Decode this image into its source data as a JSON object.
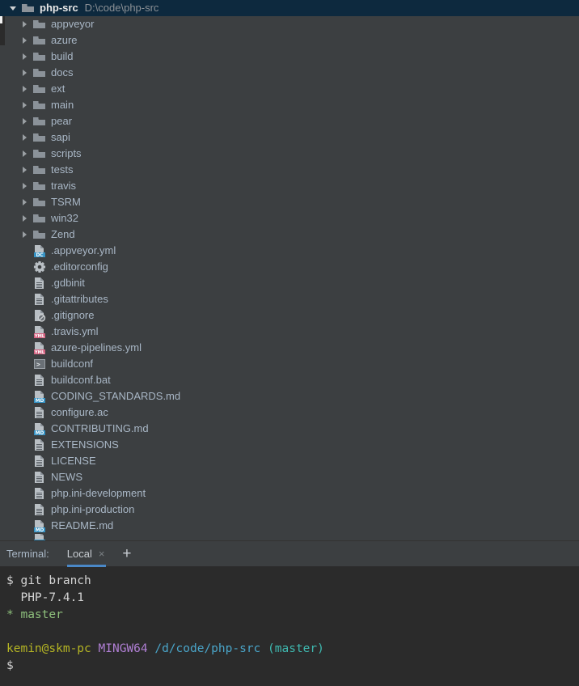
{
  "tree": {
    "root": {
      "name": "php-src",
      "path": "D:\\code\\php-src",
      "icon": "folder-icon",
      "twisty": "chevron-down-icon",
      "selected": true
    },
    "folders": [
      {
        "label": "appveyor",
        "icon": "folder-icon",
        "twisty": "chevron-right-icon"
      },
      {
        "label": "azure",
        "icon": "folder-icon",
        "twisty": "chevron-right-icon"
      },
      {
        "label": "build",
        "icon": "folder-icon",
        "twisty": "chevron-right-icon"
      },
      {
        "label": "docs",
        "icon": "folder-icon",
        "twisty": "chevron-right-icon"
      },
      {
        "label": "ext",
        "icon": "folder-icon",
        "twisty": "chevron-right-icon"
      },
      {
        "label": "main",
        "icon": "folder-icon",
        "twisty": "chevron-right-icon"
      },
      {
        "label": "pear",
        "icon": "folder-icon",
        "twisty": "chevron-right-icon"
      },
      {
        "label": "sapi",
        "icon": "folder-icon",
        "twisty": "chevron-right-icon"
      },
      {
        "label": "scripts",
        "icon": "folder-icon",
        "twisty": "chevron-right-icon"
      },
      {
        "label": "tests",
        "icon": "folder-icon",
        "twisty": "chevron-right-icon"
      },
      {
        "label": "travis",
        "icon": "folder-icon",
        "twisty": "chevron-right-icon"
      },
      {
        "label": "TSRM",
        "icon": "folder-icon",
        "twisty": "chevron-right-icon"
      },
      {
        "label": "win32",
        "icon": "folder-icon",
        "twisty": "chevron-right-icon"
      },
      {
        "label": "Zend",
        "icon": "folder-icon",
        "twisty": "chevron-right-icon"
      }
    ],
    "files": [
      {
        "label": ".appveyor.yml",
        "icon": "file-badge-icon",
        "badge": "DC",
        "badge_color": "#3592c4"
      },
      {
        "label": ".editorconfig",
        "icon": "gear-icon"
      },
      {
        "label": ".gdbinit",
        "icon": "file-text-icon"
      },
      {
        "label": ".gitattributes",
        "icon": "file-text-icon"
      },
      {
        "label": ".gitignore",
        "icon": "file-ignored-icon"
      },
      {
        "label": ".travis.yml",
        "icon": "file-badge-icon",
        "badge": "YML",
        "badge_color": "#d4607f"
      },
      {
        "label": "azure-pipelines.yml",
        "icon": "file-badge-icon",
        "badge": "YML",
        "badge_color": "#d4607f"
      },
      {
        "label": "buildconf",
        "icon": "script-icon"
      },
      {
        "label": "buildconf.bat",
        "icon": "file-text-icon"
      },
      {
        "label": "CODING_STANDARDS.md",
        "icon": "file-badge-icon",
        "badge": "MD",
        "badge_color": "#3592c4"
      },
      {
        "label": "configure.ac",
        "icon": "file-text-icon"
      },
      {
        "label": "CONTRIBUTING.md",
        "icon": "file-badge-icon",
        "badge": "MD",
        "badge_color": "#3592c4"
      },
      {
        "label": "EXTENSIONS",
        "icon": "file-text-icon"
      },
      {
        "label": "LICENSE",
        "icon": "file-text-icon"
      },
      {
        "label": "NEWS",
        "icon": "file-text-icon"
      },
      {
        "label": "php.ini-development",
        "icon": "file-text-icon"
      },
      {
        "label": "php.ini-production",
        "icon": "file-text-icon"
      },
      {
        "label": "README.md",
        "icon": "file-badge-icon",
        "badge": "MD",
        "badge_color": "#3592c4"
      }
    ]
  },
  "terminal": {
    "caption": "Terminal:",
    "tab_label": "Local",
    "tab_close": "×",
    "add_label": "+",
    "lines": [
      {
        "segments": [
          {
            "text": "$ ",
            "color": "prompt"
          },
          {
            "text": "git branch",
            "color": "white"
          }
        ]
      },
      {
        "segments": [
          {
            "text": "  PHP-7.4.1",
            "color": "white"
          }
        ]
      },
      {
        "segments": [
          {
            "text": "* ",
            "color": "green"
          },
          {
            "text": "master",
            "color": "green"
          }
        ]
      },
      {
        "segments": [
          {
            "text": "",
            "color": "white"
          }
        ]
      },
      {
        "segments": [
          {
            "text": "kemin@skm-pc",
            "color": "user"
          },
          {
            "text": " ",
            "color": "white"
          },
          {
            "text": "MINGW64",
            "color": "host"
          },
          {
            "text": " ",
            "color": "white"
          },
          {
            "text": "/d/code/php-src",
            "color": "path"
          },
          {
            "text": " ",
            "color": "white"
          },
          {
            "text": "(master)",
            "color": "branch"
          }
        ]
      },
      {
        "segments": [
          {
            "text": "$",
            "color": "prompt"
          }
        ]
      }
    ]
  },
  "colors": {
    "tree_bg": "#3c3f41",
    "terminal_bg": "#2b2b2b",
    "selection_bg": "#0d293e",
    "accent": "#4a88c7",
    "text": "#a9b7c6"
  }
}
